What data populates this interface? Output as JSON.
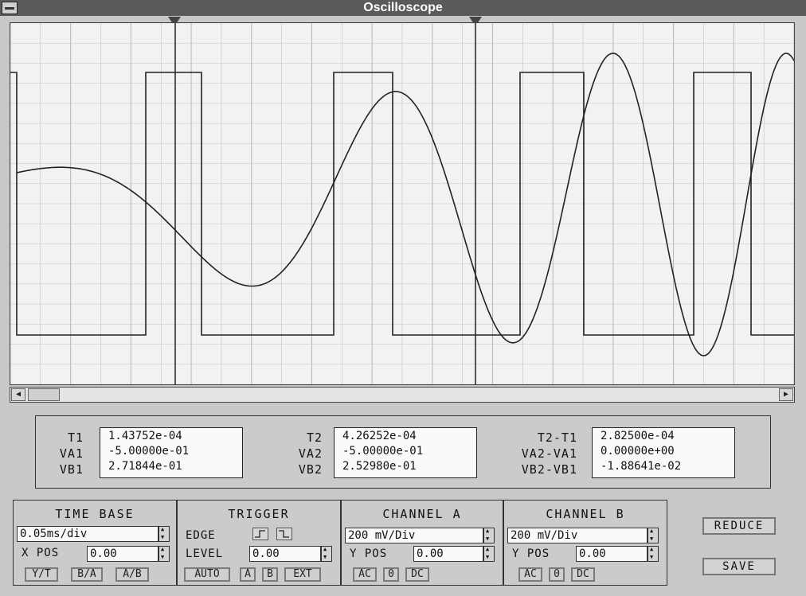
{
  "window": {
    "title": "Oscilloscope"
  },
  "cursors": {
    "t1_marker": "1",
    "t2_marker": "2"
  },
  "readout": {
    "t1_label": "T1",
    "t1": "1.43752e-04",
    "va1_label": "VA1",
    "va1": "-5.00000e-01",
    "vb1_label": "VB1",
    "vb1": "2.71844e-01",
    "t2_label": "T2",
    "t2": "4.26252e-04",
    "va2_label": "VA2",
    "va2": "-5.00000e-01",
    "vb2_label": "VB2",
    "vb2": "2.52980e-01",
    "dt_label": "T2-T1",
    "dt": "2.82500e-04",
    "dva_label": "VA2-VA1",
    "dva": "0.00000e+00",
    "dvb_label": "VB2-VB1",
    "dvb": "-1.88641e-02"
  },
  "timebase": {
    "title": "TIME BASE",
    "value": "0.05ms/div",
    "xpos_label": "X POS",
    "xpos": "0.00",
    "modes": [
      "Y/T",
      "B/A",
      "A/B"
    ]
  },
  "trigger": {
    "title": "TRIGGER",
    "edge_label": "EDGE",
    "level_label": "LEVEL",
    "level": "0.00",
    "sources": [
      "AUTO",
      "A",
      "B",
      "EXT"
    ]
  },
  "channel_a": {
    "title": "CHANNEL A",
    "value": "200 mV/Div",
    "ypos_label": "Y POS",
    "ypos": "0.00",
    "coupling": [
      "AC",
      "0",
      "DC"
    ]
  },
  "channel_b": {
    "title": "CHANNEL B",
    "value": "200 mV/Div",
    "ypos_label": "Y POS",
    "ypos": "0.00",
    "coupling": [
      "AC",
      "0",
      "DC"
    ]
  },
  "buttons": {
    "reduce": "REDUCE",
    "save": "SAVE"
  },
  "scroll": {
    "left": "◀",
    "right": "▶"
  }
}
